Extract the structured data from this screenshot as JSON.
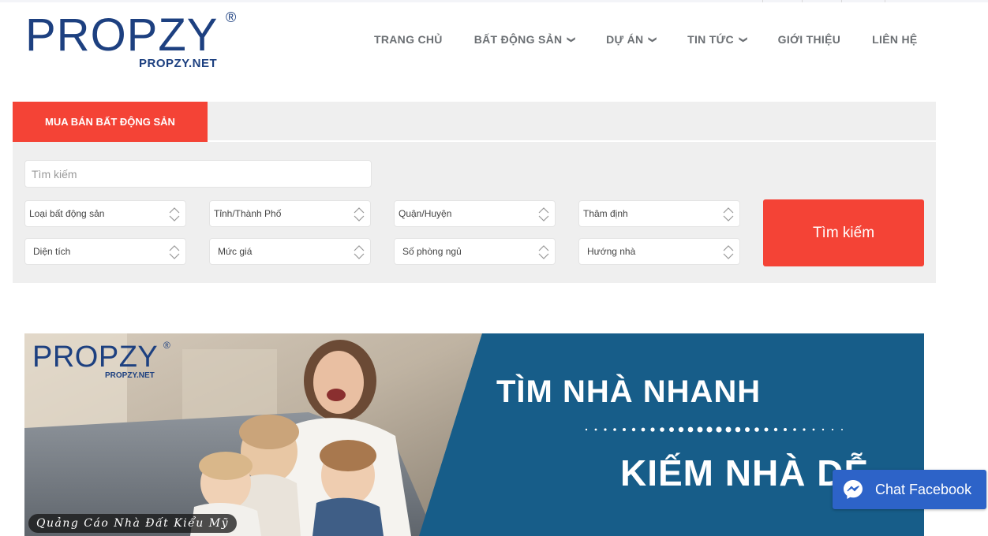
{
  "logo": {
    "wordmark": "PROPZY",
    "registered": "®",
    "domain": "PROPZY.NET"
  },
  "nav": {
    "items": [
      {
        "label": "TRANG CHỦ",
        "has_dropdown": false
      },
      {
        "label": "BẤT ĐỘNG SẢN",
        "has_dropdown": true
      },
      {
        "label": "DỰ ÁN",
        "has_dropdown": true
      },
      {
        "label": "TIN TỨC",
        "has_dropdown": true
      },
      {
        "label": "GIỚI THIỆU",
        "has_dropdown": false
      },
      {
        "label": "LIÊN HỆ",
        "has_dropdown": false
      }
    ]
  },
  "search": {
    "tab_label": "MUA BÁN BẤT ĐỘNG SẢN",
    "keyword_placeholder": "Tìm kiếm",
    "filters": {
      "property_type": "Loại bất động sản",
      "city": "Tỉnh/Thành Phố",
      "district": "Quận/Huyện",
      "appraisal": "Thâm định",
      "area": "Diện tích",
      "price": "Mức giá",
      "bedrooms": "Số phòng ngủ",
      "direction": "Hướng nhà"
    },
    "submit_label": "Tìm kiếm"
  },
  "banner": {
    "logo_word": "PROPZY",
    "logo_registered": "®",
    "logo_domain": "PROPZY.NET",
    "caption": "Quảng Cáo Nhà Đất Kiểu Mỹ",
    "headline_1": "TÌM NHÀ NHANH",
    "headline_2": "KIẾM NHÀ DỄ"
  },
  "chat": {
    "label": "Chat Facebook",
    "icon": "messenger-icon"
  },
  "colors": {
    "brand_blue": "#1d4080",
    "accent_red": "#f44336",
    "banner_blue": "#175d89",
    "chat_blue": "#2d63c8"
  }
}
